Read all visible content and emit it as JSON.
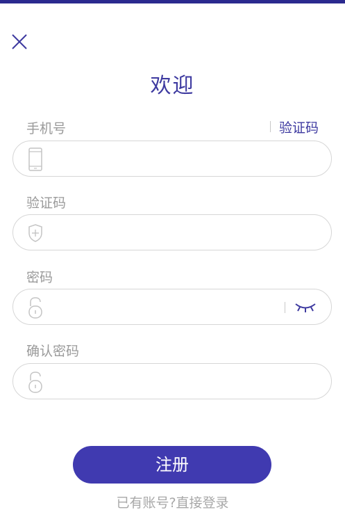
{
  "header": {
    "title": "欢迎",
    "close_icon": "close-icon",
    "accent_color": "#3e3aa0",
    "top_bar_color": "#2b2a8f"
  },
  "form": {
    "phone": {
      "label": "手机号",
      "icon": "mobile-phone-icon",
      "value": ""
    },
    "send_code": {
      "label": "验证码"
    },
    "code": {
      "label": "验证码",
      "icon": "shield-plus-icon",
      "value": ""
    },
    "password": {
      "label": "密码",
      "icon": "unlock-icon",
      "toggle_icon": "eye-closed-icon",
      "value": ""
    },
    "confirm_password": {
      "label": "确认密码",
      "icon": "unlock-icon",
      "value": ""
    }
  },
  "actions": {
    "register_label": "注册",
    "register_color": "#403ab0",
    "login_link": "已有账号?直接登录"
  }
}
